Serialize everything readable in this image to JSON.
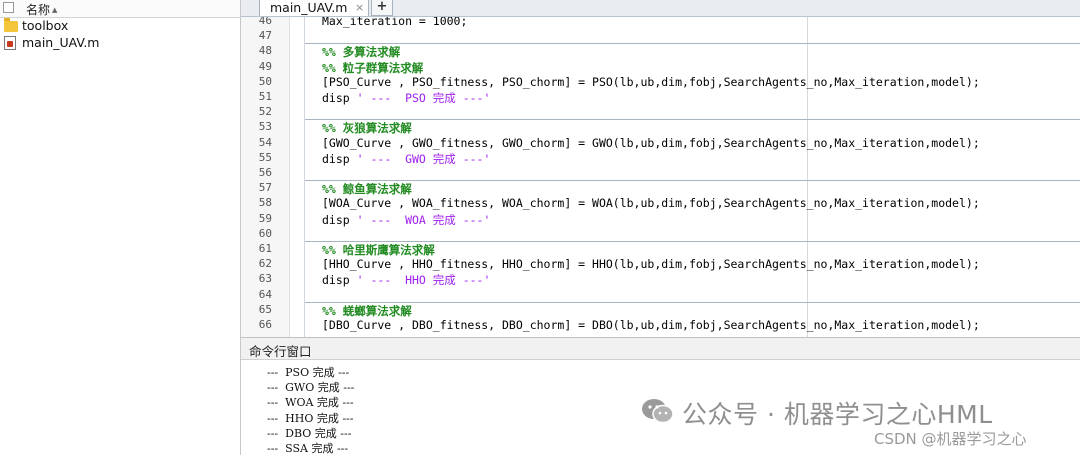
{
  "file_browser": {
    "column_header": "名称",
    "items": [
      {
        "name": "toolbox",
        "type": "folder"
      },
      {
        "name": "main_UAV.m",
        "type": "m-file"
      }
    ]
  },
  "editor": {
    "tab_label": "main_UAV.m",
    "tab_close": "×",
    "tab_add": "+",
    "lines": [
      {
        "n": "46",
        "text": "Max_iteration = 1000;"
      },
      {
        "n": "47",
        "text": ""
      },
      {
        "n": "48",
        "text": "%% 多算法求解",
        "comment": true
      },
      {
        "n": "49",
        "text": "%% 粒子群算法求解",
        "comment": true
      },
      {
        "n": "50",
        "text": "[PSO_Curve , PSO_fitness, PSO_chorm] = PSO(lb,ub,dim,fobj,SearchAgents_no,Max_iteration,model);"
      },
      {
        "n": "51",
        "text": "disp ",
        "str": "' ---  PSO 完成 ---'"
      },
      {
        "n": "52",
        "text": ""
      },
      {
        "n": "53",
        "text": "%% 灰狼算法求解",
        "comment": true
      },
      {
        "n": "54",
        "text": "[GWO_Curve , GWO_fitness, GWO_chorm] = GWO(lb,ub,dim,fobj,SearchAgents_no,Max_iteration,model);"
      },
      {
        "n": "55",
        "text": "disp ",
        "str": "' ---  GWO 完成 ---'"
      },
      {
        "n": "56",
        "text": ""
      },
      {
        "n": "57",
        "text": "%% 鲸鱼算法求解",
        "comment": true
      },
      {
        "n": "58",
        "text": "[WOA_Curve , WOA_fitness, WOA_chorm] = WOA(lb,ub,dim,fobj,SearchAgents_no,Max_iteration,model);"
      },
      {
        "n": "59",
        "text": "disp ",
        "str": "' ---  WOA 完成 ---'"
      },
      {
        "n": "60",
        "text": ""
      },
      {
        "n": "61",
        "text": "%% 哈里斯鹰算法求解",
        "comment": true
      },
      {
        "n": "62",
        "text": "[HHO_Curve , HHO_fitness, HHO_chorm] = HHO(lb,ub,dim,fobj,SearchAgents_no,Max_iteration,model);"
      },
      {
        "n": "63",
        "text": "disp ",
        "str": "' ---  HHO 完成 ---'"
      },
      {
        "n": "64",
        "text": ""
      },
      {
        "n": "65",
        "text": "%% 蜣螂算法求解",
        "comment": true
      },
      {
        "n": "66",
        "text": "[DBO_Curve , DBO_fitness, DBO_chorm] = DBO(lb,ub,dim,fobj,SearchAgents_no,Max_iteration,model);"
      }
    ]
  },
  "command_window": {
    "title": "命令行窗口",
    "output": [
      "---  PSO 完成 ---",
      "---  GWO 完成 ---",
      "---  WOA 完成 ---",
      "---  HHO 完成 ---",
      "---  DBO 完成 ---",
      "---  SSA 完成 ---"
    ]
  },
  "watermark": {
    "main": "公众号 · 机器学习之心HML",
    "csdn": "CSDN @机器学习之心"
  },
  "colors": {
    "comment": "#228b22",
    "string": "#a020f0",
    "folder": "#f3c53b"
  }
}
